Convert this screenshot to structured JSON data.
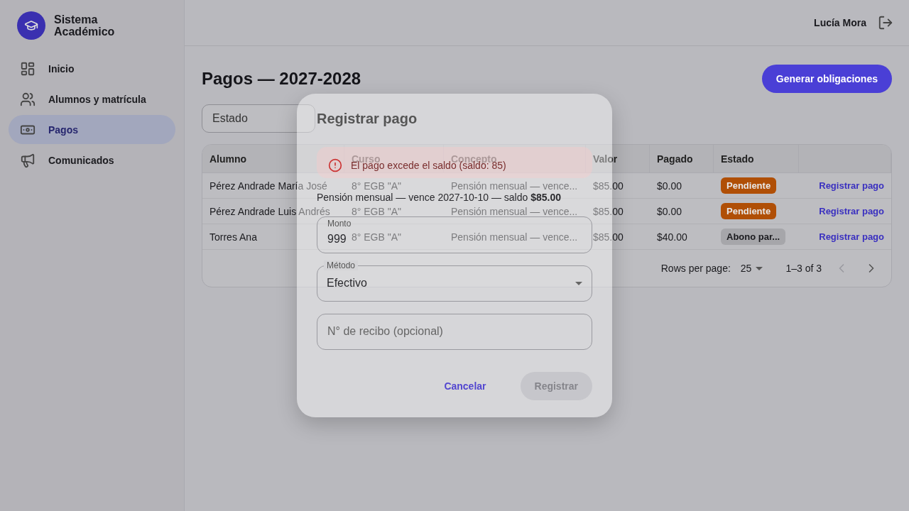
{
  "brand": {
    "title": "Sistema Académico"
  },
  "sidebar": {
    "items": [
      {
        "label": "Inicio",
        "selected": false
      },
      {
        "label": "Alumnos y matrícula",
        "selected": false
      },
      {
        "label": "Pagos",
        "selected": true
      },
      {
        "label": "Comunicados",
        "selected": false
      }
    ]
  },
  "topbar": {
    "user": "Lucía Mora"
  },
  "page": {
    "title": "Pagos — 2027-2028",
    "action": "Generar obligaciones",
    "filter": {
      "label": "Estado"
    }
  },
  "table": {
    "columns": [
      "Alumno",
      "Curso",
      "Concepto",
      "Valor",
      "Pagado",
      "Estado"
    ],
    "rows": [
      {
        "alumno": "Pérez Andrade María José",
        "curso": "8° EGB \"A\"",
        "concepto": "Pensión mensual — vence...",
        "valor": "$85.00",
        "pagado": "$0.00",
        "estado": "Pendiente",
        "color": "#b04f06",
        "action": "Registrar pago"
      },
      {
        "alumno": "Pérez Andrade Luis Andrés",
        "curso": "8° EGB \"A\"",
        "concepto": "Pensión mensual — vence...",
        "valor": "$85.00",
        "pagado": "$0.00",
        "estado": "Pendiente",
        "color": "#b04f06",
        "action": "Registrar pago"
      },
      {
        "alumno": "Torres Ana",
        "curso": "8° EGB \"A\"",
        "concepto": "Pensión mensual — vence...",
        "valor": "$85.00",
        "pagado": "$40.00",
        "estado": "Abono par...",
        "color": "#a6a6aa",
        "action": "Registrar pago"
      }
    ],
    "footer": {
      "rows_label": "Rows per page:",
      "rows_value": "25",
      "range": "1–3 of 3",
      "prev_disabled": true,
      "next_disabled": false
    }
  },
  "dialog": {
    "title": "Registrar pago",
    "alert": "El pago excede el saldo (saldo: 85)",
    "summary": "Pensión mensual — vence 2027-10-10 — saldo **$85.00**",
    "fields": [
      {
        "kind": "text",
        "label": "Monto",
        "value": "999"
      },
      {
        "kind": "select",
        "label": "Método",
        "value": "Efectivo"
      },
      {
        "kind": "text",
        "placeholder": "N° de recibo (opcional)"
      }
    ],
    "buttons": [
      {
        "label": "Cancelar",
        "kind": "text",
        "disabled": false
      },
      {
        "label": "Registrar",
        "kind": "contained",
        "disabled": true
      }
    ]
  }
}
